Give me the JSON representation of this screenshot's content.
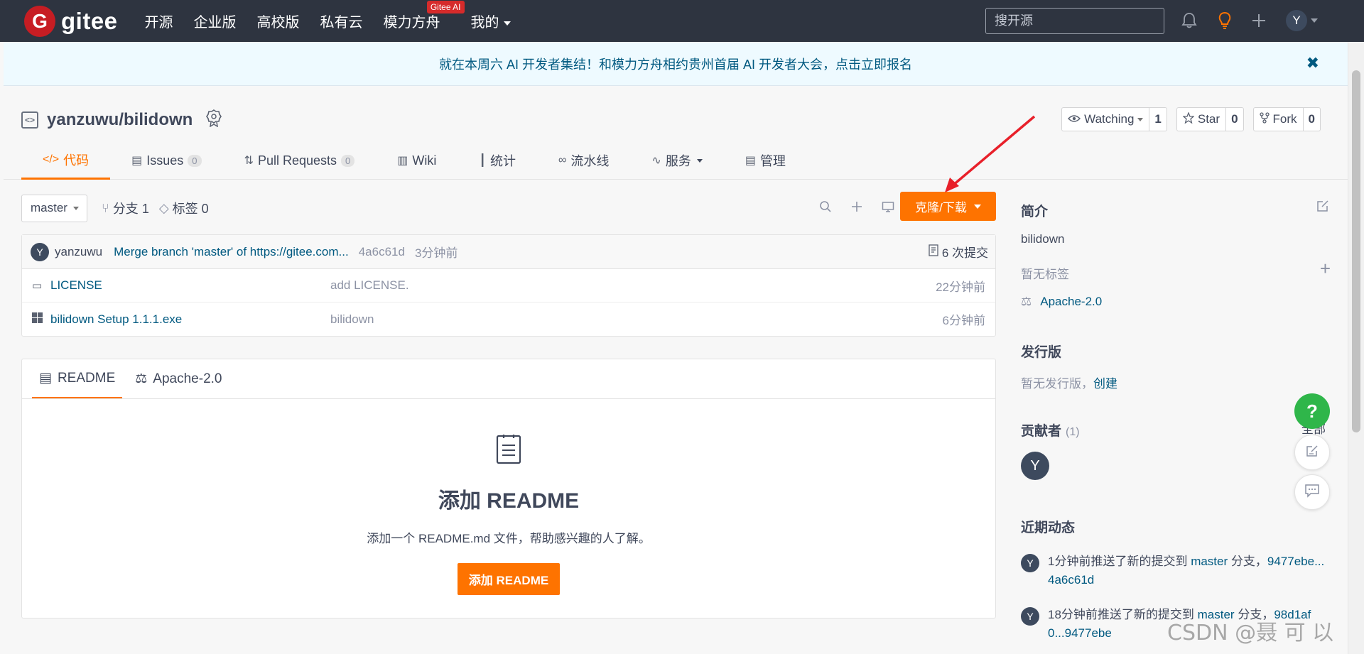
{
  "topnav": {
    "logo_mark": "G",
    "logo_text": "gitee",
    "links": [
      "开源",
      "企业版",
      "高校版",
      "私有云",
      "模力方舟",
      "我的"
    ],
    "ai_badge": "Gitee AI",
    "search_placeholder": "搜开源",
    "avatar": "Y",
    "icons": [
      "bell-icon",
      "lightbulb-icon",
      "plus-icon"
    ]
  },
  "banner": {
    "text": "就在本周六 AI 开发者集结！和模力方舟相约贵州首届 AI 开发者大会，点击立即报名",
    "close": "✖"
  },
  "repo": {
    "title": "yanzuwu/bilidown",
    "watching_label": "Watching",
    "watching_count": "1",
    "star_label": "Star",
    "star_count": "0",
    "fork_label": "Fork",
    "fork_count": "0"
  },
  "tabs": [
    {
      "label": "代码",
      "icon": "code-icon"
    },
    {
      "label": "Issues",
      "count": "0",
      "icon": "issues-icon"
    },
    {
      "label": "Pull Requests",
      "count": "0",
      "icon": "pull-request-icon"
    },
    {
      "label": "Wiki",
      "icon": "book-icon"
    },
    {
      "label": "统计",
      "icon": "chart-icon"
    },
    {
      "label": "流水线",
      "icon": "pipeline-icon"
    },
    {
      "label": "服务",
      "icon": "pulse-icon"
    },
    {
      "label": "管理",
      "icon": "manage-icon"
    }
  ],
  "branch": {
    "current": "master",
    "branches": "分支 1",
    "tags": "标签 0",
    "clone_label": "克隆/下载"
  },
  "commit": {
    "avatar": "Y",
    "author": "yanzuwu",
    "message": "Merge branch 'master' of https://gitee.com...",
    "hash": "4a6c61d",
    "time": "3分钟前",
    "count": "6 次提交"
  },
  "files": [
    {
      "name": "LICENSE",
      "message": "add LICENSE.",
      "time": "22分钟前",
      "icon": "license-icon"
    },
    {
      "name": "bilidown Setup 1.1.1.exe",
      "message": "bilidown",
      "time": "6分钟前",
      "icon": "windows-icon"
    }
  ],
  "readme": {
    "tab_readme": "README",
    "tab_license": "Apache-2.0",
    "title": "添加 README",
    "desc": "添加一个 README.md 文件，帮助感兴趣的人了解。",
    "button": "添加 README"
  },
  "sidebar": {
    "intro_title": "简介",
    "description": "bilidown",
    "no_tags": "暂无标签",
    "license": "Apache-2.0",
    "release_title": "发行版",
    "no_release": "暂无发行版，",
    "create": "创建",
    "contributors_title": "贡献者",
    "contributors_count": "(1)",
    "contributor_all": "全部",
    "contributor_avatar": "Y",
    "activity_title": "近期动态",
    "activities": [
      {
        "avatar": "Y",
        "pre": "1分钟前推送了新的提交到 ",
        "branch": "master",
        "mid": " 分支，",
        "range": "9477ebe...4a6c61d"
      },
      {
        "avatar": "Y",
        "pre": "18分钟前推送了新的提交到 ",
        "branch": "master",
        "mid": " 分支，",
        "range": "98d1af0...9477ebe"
      }
    ]
  },
  "floating": {
    "help": "?"
  },
  "watermark": "CSDN @聂 可 以",
  "colors": {
    "nav_bg": "#2e3440",
    "accent": "#fe7300",
    "link": "#005980",
    "logo_red": "#c71d23",
    "help_green": "#2fb64a",
    "annotation_arrow": "#e8202a"
  }
}
